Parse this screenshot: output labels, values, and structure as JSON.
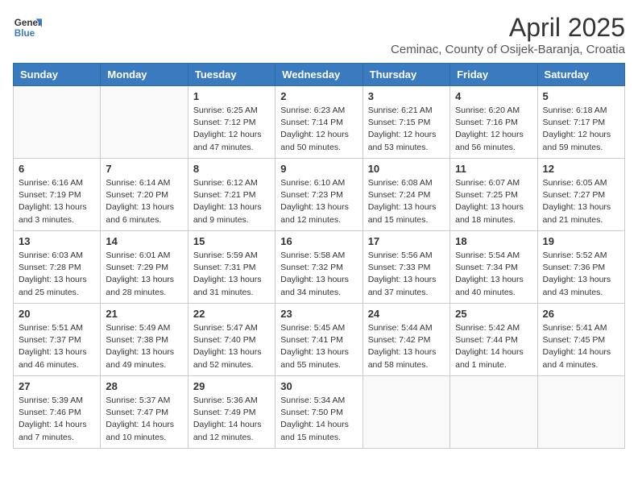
{
  "logo": {
    "line1": "General",
    "line2": "Blue"
  },
  "title": "April 2025",
  "subtitle": "Ceminac, County of Osijek-Baranja, Croatia",
  "weekdays": [
    "Sunday",
    "Monday",
    "Tuesday",
    "Wednesday",
    "Thursday",
    "Friday",
    "Saturday"
  ],
  "weeks": [
    [
      null,
      null,
      {
        "day": "1",
        "sunrise": "6:25 AM",
        "sunset": "7:12 PM",
        "daylight": "12 hours and 47 minutes."
      },
      {
        "day": "2",
        "sunrise": "6:23 AM",
        "sunset": "7:14 PM",
        "daylight": "12 hours and 50 minutes."
      },
      {
        "day": "3",
        "sunrise": "6:21 AM",
        "sunset": "7:15 PM",
        "daylight": "12 hours and 53 minutes."
      },
      {
        "day": "4",
        "sunrise": "6:20 AM",
        "sunset": "7:16 PM",
        "daylight": "12 hours and 56 minutes."
      },
      {
        "day": "5",
        "sunrise": "6:18 AM",
        "sunset": "7:17 PM",
        "daylight": "12 hours and 59 minutes."
      }
    ],
    [
      {
        "day": "6",
        "sunrise": "6:16 AM",
        "sunset": "7:19 PM",
        "daylight": "13 hours and 3 minutes."
      },
      {
        "day": "7",
        "sunrise": "6:14 AM",
        "sunset": "7:20 PM",
        "daylight": "13 hours and 6 minutes."
      },
      {
        "day": "8",
        "sunrise": "6:12 AM",
        "sunset": "7:21 PM",
        "daylight": "13 hours and 9 minutes."
      },
      {
        "day": "9",
        "sunrise": "6:10 AM",
        "sunset": "7:23 PM",
        "daylight": "13 hours and 12 minutes."
      },
      {
        "day": "10",
        "sunrise": "6:08 AM",
        "sunset": "7:24 PM",
        "daylight": "13 hours and 15 minutes."
      },
      {
        "day": "11",
        "sunrise": "6:07 AM",
        "sunset": "7:25 PM",
        "daylight": "13 hours and 18 minutes."
      },
      {
        "day": "12",
        "sunrise": "6:05 AM",
        "sunset": "7:27 PM",
        "daylight": "13 hours and 21 minutes."
      }
    ],
    [
      {
        "day": "13",
        "sunrise": "6:03 AM",
        "sunset": "7:28 PM",
        "daylight": "13 hours and 25 minutes."
      },
      {
        "day": "14",
        "sunrise": "6:01 AM",
        "sunset": "7:29 PM",
        "daylight": "13 hours and 28 minutes."
      },
      {
        "day": "15",
        "sunrise": "5:59 AM",
        "sunset": "7:31 PM",
        "daylight": "13 hours and 31 minutes."
      },
      {
        "day": "16",
        "sunrise": "5:58 AM",
        "sunset": "7:32 PM",
        "daylight": "13 hours and 34 minutes."
      },
      {
        "day": "17",
        "sunrise": "5:56 AM",
        "sunset": "7:33 PM",
        "daylight": "13 hours and 37 minutes."
      },
      {
        "day": "18",
        "sunrise": "5:54 AM",
        "sunset": "7:34 PM",
        "daylight": "13 hours and 40 minutes."
      },
      {
        "day": "19",
        "sunrise": "5:52 AM",
        "sunset": "7:36 PM",
        "daylight": "13 hours and 43 minutes."
      }
    ],
    [
      {
        "day": "20",
        "sunrise": "5:51 AM",
        "sunset": "7:37 PM",
        "daylight": "13 hours and 46 minutes."
      },
      {
        "day": "21",
        "sunrise": "5:49 AM",
        "sunset": "7:38 PM",
        "daylight": "13 hours and 49 minutes."
      },
      {
        "day": "22",
        "sunrise": "5:47 AM",
        "sunset": "7:40 PM",
        "daylight": "13 hours and 52 minutes."
      },
      {
        "day": "23",
        "sunrise": "5:45 AM",
        "sunset": "7:41 PM",
        "daylight": "13 hours and 55 minutes."
      },
      {
        "day": "24",
        "sunrise": "5:44 AM",
        "sunset": "7:42 PM",
        "daylight": "13 hours and 58 minutes."
      },
      {
        "day": "25",
        "sunrise": "5:42 AM",
        "sunset": "7:44 PM",
        "daylight": "14 hours and 1 minute."
      },
      {
        "day": "26",
        "sunrise": "5:41 AM",
        "sunset": "7:45 PM",
        "daylight": "14 hours and 4 minutes."
      }
    ],
    [
      {
        "day": "27",
        "sunrise": "5:39 AM",
        "sunset": "7:46 PM",
        "daylight": "14 hours and 7 minutes."
      },
      {
        "day": "28",
        "sunrise": "5:37 AM",
        "sunset": "7:47 PM",
        "daylight": "14 hours and 10 minutes."
      },
      {
        "day": "29",
        "sunrise": "5:36 AM",
        "sunset": "7:49 PM",
        "daylight": "14 hours and 12 minutes."
      },
      {
        "day": "30",
        "sunrise": "5:34 AM",
        "sunset": "7:50 PM",
        "daylight": "14 hours and 15 minutes."
      },
      null,
      null,
      null
    ]
  ],
  "labels": {
    "sunrise": "Sunrise:",
    "sunset": "Sunset:",
    "daylight": "Daylight:"
  }
}
